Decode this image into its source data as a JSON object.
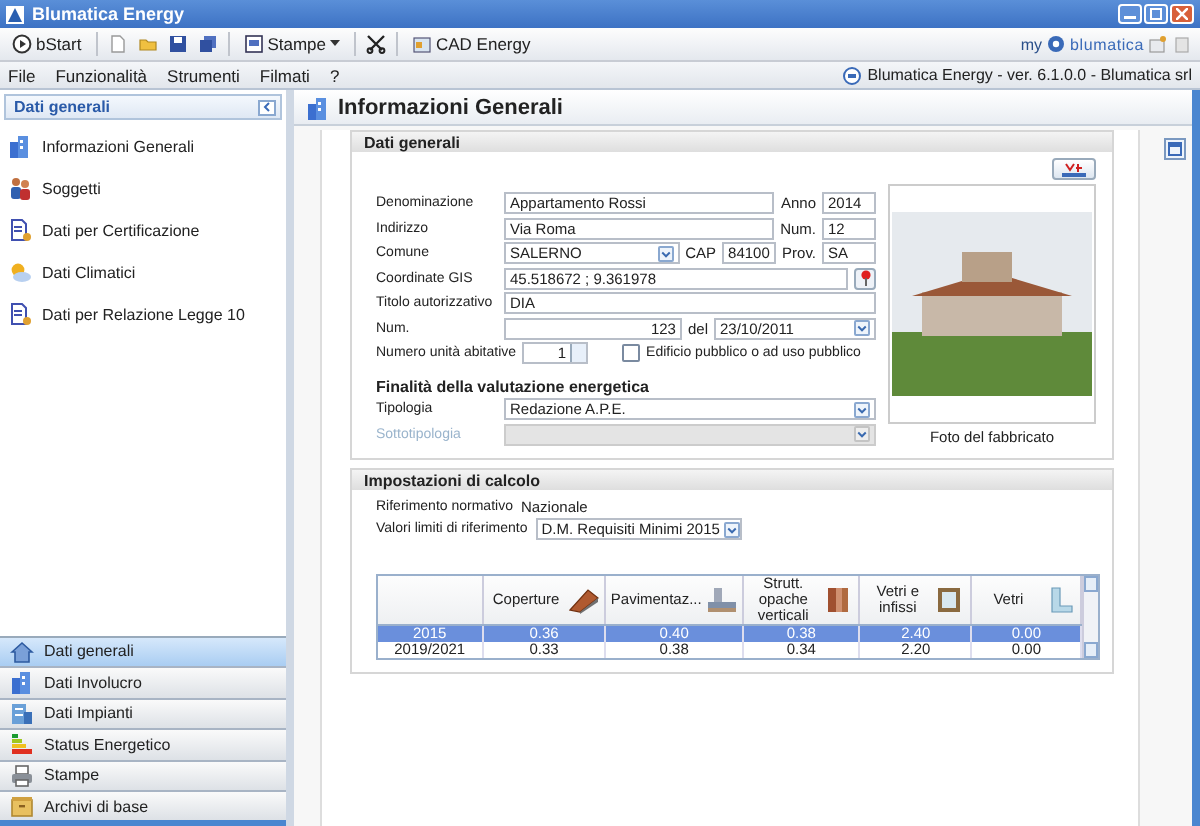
{
  "window": {
    "title": "Blumatica Energy"
  },
  "toolbar": {
    "start": "bStart",
    "print": "Stampe",
    "cad": "CAD Energy",
    "brand_prefix": "my",
    "brand": "blumatica"
  },
  "menu": [
    {
      "label": "File"
    },
    {
      "label": "Funzionalità"
    },
    {
      "label": "Strumenti"
    },
    {
      "label": "Filmati"
    },
    {
      "label": "?"
    }
  ],
  "version": "Blumatica Energy - ver. 6.1.0.0 - Blumatica srl",
  "sidebar": {
    "title": "Dati generali",
    "items": [
      {
        "label": "Informazioni Generali",
        "kind": "building"
      },
      {
        "label": "Soggetti",
        "kind": "people"
      },
      {
        "label": "Dati per Certificazione",
        "kind": "document"
      },
      {
        "label": "Dati Climatici",
        "kind": "weather"
      },
      {
        "label": "Dati per Relazione Legge 10",
        "kind": "document"
      }
    ]
  },
  "sections": [
    {
      "label": "Dati generali",
      "kind": "house",
      "selected": true
    },
    {
      "label": "Dati Involucro",
      "kind": "building",
      "selected": false
    },
    {
      "label": "Dati Impianti",
      "kind": "plant",
      "selected": false
    },
    {
      "label": "Status Energetico",
      "kind": "energy",
      "selected": false
    },
    {
      "label": "Stampe",
      "kind": "printer",
      "selected": false
    },
    {
      "label": "Archivi di base",
      "kind": "archive",
      "selected": false
    }
  ],
  "page": {
    "title": "Informazioni Generali"
  },
  "general": {
    "title": "Dati generali",
    "photo_caption": "Foto del fabbricato",
    "subheading": "Finalità della valutazione energetica",
    "rows": [
      {
        "label": "Denominazione",
        "disabled": false,
        "cells": [
          {
            "kind": "text",
            "value": "Appartamento Rossi"
          },
          {
            "kind": "caption",
            "value": "Anno"
          },
          {
            "kind": "short",
            "value": "2014"
          }
        ]
      },
      {
        "label": "Indirizzo",
        "disabled": false,
        "cells": [
          {
            "kind": "text",
            "value": "Via Roma"
          },
          {
            "kind": "caption",
            "value": "Num."
          },
          {
            "kind": "short",
            "value": "12"
          }
        ]
      },
      {
        "label": "Comune",
        "disabled": false,
        "cells": [
          {
            "kind": "combo",
            "value": "SALERNO"
          },
          {
            "kind": "caption",
            "value": "CAP"
          },
          {
            "kind": "short",
            "value": "84100"
          },
          {
            "kind": "caption",
            "value": "Prov."
          },
          {
            "kind": "short",
            "value": "SA"
          }
        ]
      },
      {
        "label": "Coordinate GIS",
        "disabled": false,
        "cells": [
          {
            "kind": "text",
            "value": "45.518672 ; 9.361978"
          },
          {
            "kind": "pin"
          }
        ]
      },
      {
        "label": "Titolo autorizzativo",
        "disabled": false,
        "cells": [
          {
            "kind": "text",
            "value": "DIA"
          }
        ]
      },
      {
        "label": "Num.",
        "disabled": false,
        "cells": [
          {
            "kind": "number",
            "value": "123"
          },
          {
            "kind": "caption",
            "value": "del"
          },
          {
            "kind": "date",
            "value": "23/10/2011"
          }
        ]
      },
      {
        "label": "Numero unità abitative",
        "disabled": false,
        "cells": [
          {
            "kind": "spin",
            "value": "1"
          },
          {
            "kind": "checkbox",
            "value": "Edificio pubblico o ad uso pubblico",
            "checked": false
          }
        ]
      }
    ],
    "purpose_rows": [
      {
        "label": "Tipologia",
        "disabled": false,
        "cells": [
          {
            "kind": "combo",
            "value": "Redazione A.P.E."
          }
        ]
      },
      {
        "label": "Sottotipologia",
        "disabled": true,
        "cells": [
          {
            "kind": "combo"
          }
        ]
      }
    ]
  },
  "calc": {
    "title": "Impostazioni di calcolo",
    "reference_label": "Riferimento normativo",
    "reference_value": "Nazionale",
    "limits_label": "Valori limiti di riferimento",
    "limits_value": "D.M. Requisiti Minimi 2015",
    "table": {
      "columns": [
        {
          "label": "Coperture",
          "kind": "roof"
        },
        {
          "label": "Pavimentaz...",
          "kind": "floor"
        },
        {
          "label": "Strutt. opache verticali",
          "kind": "wall"
        },
        {
          "label": "Vetri e infissi",
          "kind": "window"
        },
        {
          "label": "Vetri",
          "kind": "glass"
        }
      ],
      "rows": [
        {
          "label": "2015",
          "values": [
            "0.36",
            "0.40",
            "0.38",
            "2.40",
            "0.00"
          ],
          "selected": true
        },
        {
          "label": "2019/2021",
          "values": [
            "0.33",
            "0.38",
            "0.34",
            "2.20",
            "0.00"
          ],
          "selected": false
        }
      ]
    }
  }
}
